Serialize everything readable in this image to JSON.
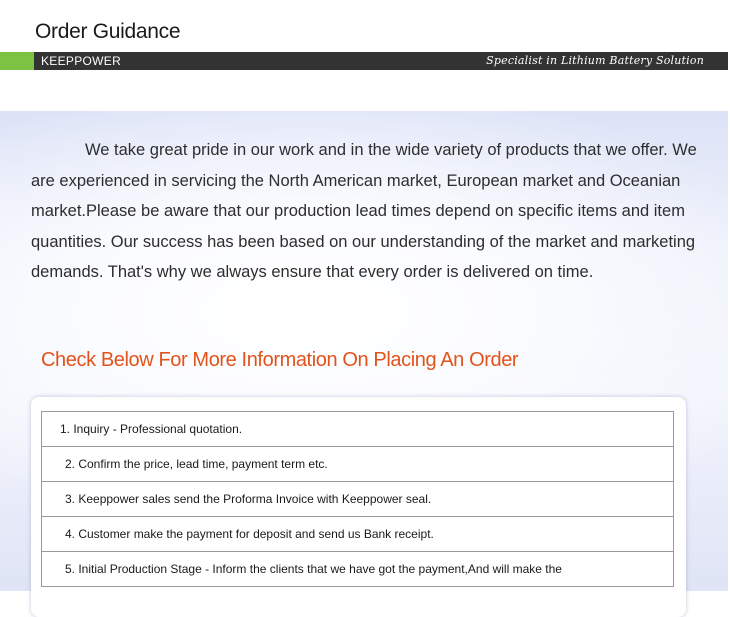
{
  "header": {
    "title": "Order Guidance",
    "brand": "KEEPPOWER",
    "slogan": "Specialist in Lithium Battery Solution",
    "accent_color": "#7dc242",
    "bar_color": "#333333"
  },
  "intro": {
    "text": "We take great pride in our work and in the wide variety of products that we offer. We are experienced in servicing the North American market, European market and Oceanian market.Please be aware that our production lead times depend on specific items and item quantities. Our success has been based on our understanding of the market and marketing demands. That's why we always ensure that every order is delivered on time."
  },
  "section": {
    "heading": "Check Below For More Information On Placing An Order",
    "heading_color": "#e2531c"
  },
  "steps": [
    "1. Inquiry - Professional quotation.",
    "2. Confirm the price, lead time, payment term etc.",
    "3. Keeppower sales send the Proforma Invoice with Keeppower seal.",
    "4. Customer make the payment for deposit and send us Bank receipt.",
    "5. Initial Production Stage - Inform the clients that we have got the payment,And will make the"
  ]
}
